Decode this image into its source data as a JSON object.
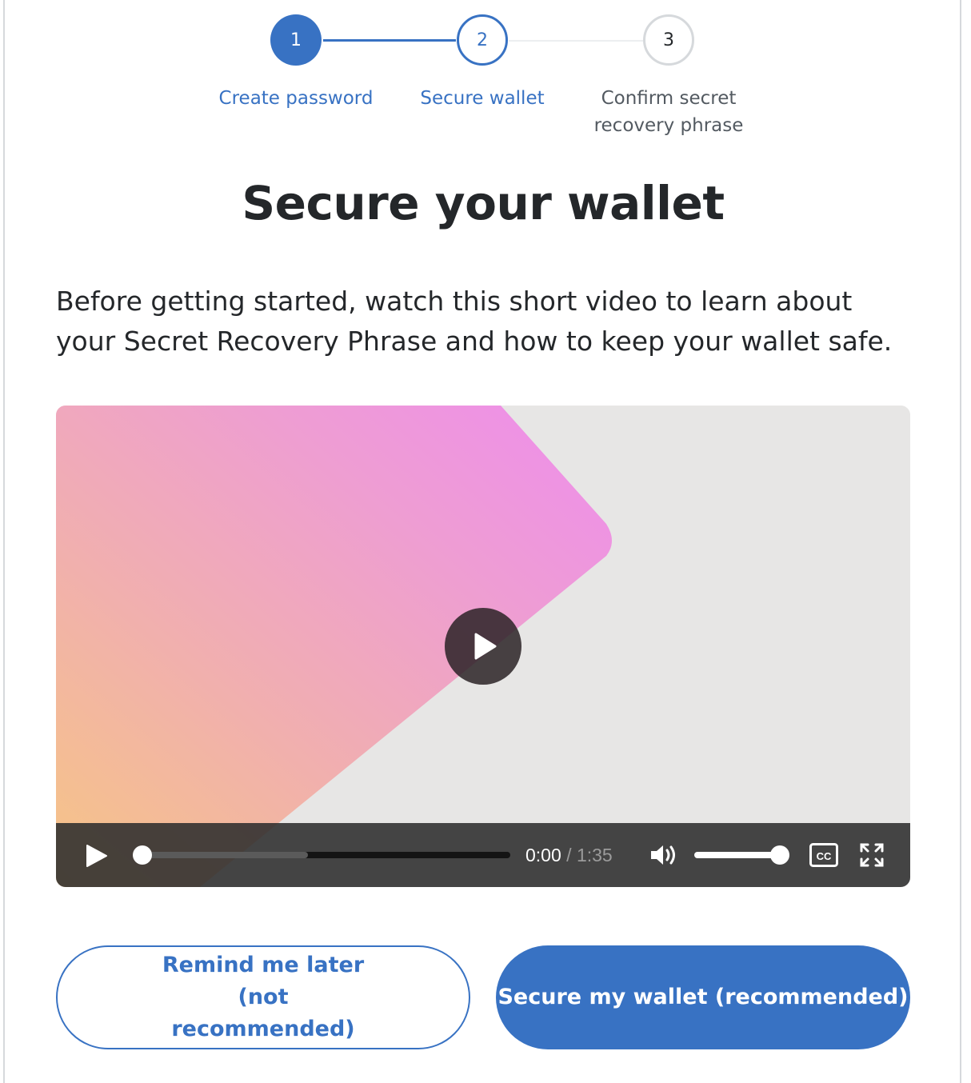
{
  "stepper": {
    "steps": [
      {
        "number": "1",
        "label": "Create password",
        "state": "complete"
      },
      {
        "number": "2",
        "label": "Secure wallet",
        "state": "active"
      },
      {
        "number": "3",
        "label": "Confirm secret recovery phrase",
        "state": "upcoming"
      }
    ]
  },
  "page": {
    "title": "Secure your wallet",
    "description": "Before getting started, watch this short video to learn about your Secret Recovery Phrase and how to keep your wallet safe."
  },
  "video": {
    "current_time": "0:00",
    "separator": " / ",
    "duration": "1:35",
    "cc_label": "CC",
    "buffered_fraction": 0.45,
    "volume_fraction": 1.0
  },
  "actions": {
    "remind_later_label": "Remind me later (not recommended)",
    "secure_wallet_label": "Secure my wallet (recommended)"
  },
  "colors": {
    "accent": "#3872c3",
    "text": "#24272a",
    "muted": "#535a61"
  }
}
